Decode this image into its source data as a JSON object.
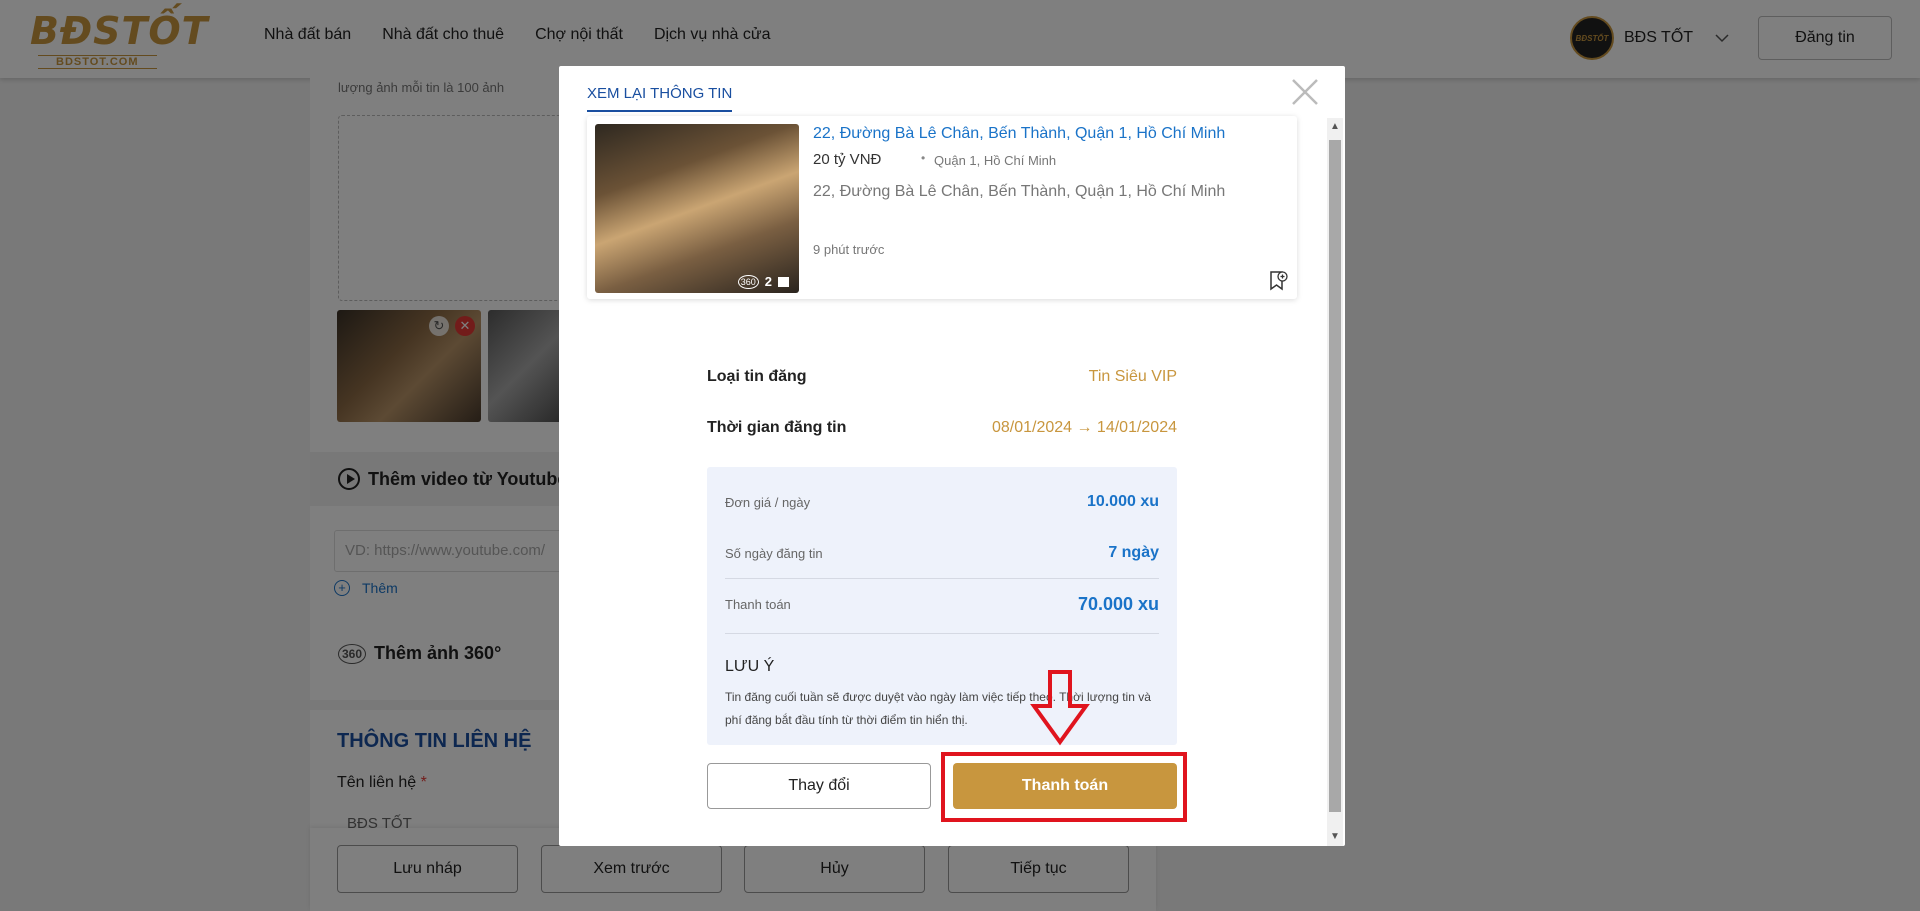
{
  "header": {
    "logo_main": "BĐSTỐT",
    "logo_sub": "BDSTOT.COM",
    "nav": [
      "Nhà đất bán",
      "Nhà đất cho thuê",
      "Chợ nội thất",
      "Dịch vụ nhà cửa"
    ],
    "avatar_text": "BĐSTỐT",
    "user_name": "BĐS TỐT",
    "post_button": "Đăng tin"
  },
  "form": {
    "photo_hint": "lượng ảnh mỗi tin là 100 ảnh",
    "thumb_rotate_icon": "↻",
    "thumb_delete_icon": "✕",
    "video_title": "Thêm video từ Youtube",
    "youtube_placeholder": "VD: https://www.youtube.com/",
    "add_icon": "+",
    "add_label": "Thêm",
    "pano_icon": "360",
    "pano_title": "Thêm ảnh 360°",
    "contact_title": "THÔNG TIN LIÊN HỆ",
    "contact_name_label": "Tên liên hệ",
    "required_mark": "*",
    "contact_name_value": "BĐS TỐT"
  },
  "footer": {
    "draft": "Lưu nháp",
    "preview": "Xem trước",
    "cancel": "Hủy",
    "next": "Tiếp tục"
  },
  "modal": {
    "tab": "XEM LẠI THÔNG TIN",
    "listing": {
      "title": "22, Đường Bà Lê Chân, Bến Thành, Quận 1, Hồ Chí Minh",
      "price": "20 tỷ VNĐ",
      "dot": "•",
      "location": "Quận 1, Hồ Chí Minh",
      "address": "22, Đường Bà Lê Chân, Bến Thành, Quận 1, Hồ Chí Minh",
      "time": "9 phút trước",
      "badge_360": "360",
      "photo_count": "2"
    },
    "post_type_label": "Loại tin đăng",
    "post_type_value": "Tin Siêu VIP",
    "post_time_label": "Thời gian đăng tin",
    "post_time_value": "08/01/2024 → 14/01/2024",
    "unit_price_label": "Đơn giá / ngày",
    "unit_price_value": "10.000 xu",
    "days_label": "Số ngày đăng tin",
    "days_value": "7 ngày",
    "total_label": "Thanh toán",
    "total_value": "70.000 xu",
    "note_title": "LƯU Ý",
    "note_text": "Tin đăng cuối tuần sẽ được duyệt vào ngày làm việc tiếp theo. Thời lượng tin và phí đăng bắt đầu tính từ thời điểm tin hiển thị.",
    "change_button": "Thay đổi",
    "pay_button": "Thanh toán",
    "scroll_up_icon": "▲",
    "scroll_down_icon": "▼"
  },
  "colors": {
    "brand_gold": "#c8963e",
    "link_blue": "#1a73c8",
    "highlight_red": "#e0141e"
  }
}
